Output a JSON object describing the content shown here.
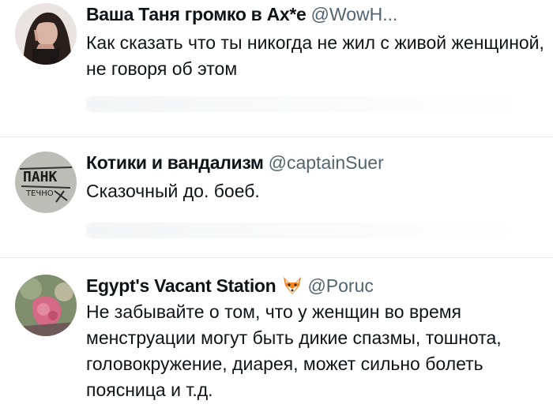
{
  "tweets": [
    {
      "display_name": "Ваша Таня громко в Ах*е",
      "handle": "@WowH...",
      "text": "Как сказать что ты никогда не жил с живой женщиной, не говоря об этом",
      "avatar_icon": "woman-portrait-avatar"
    },
    {
      "display_name": "Котики и вандализм",
      "handle": "@captainSuer",
      "text": "Сказочный до. боеб.",
      "avatar_icon": "graffiti-avatar",
      "avatar_graffiti_text": "ПАНК ТЕЧНО"
    },
    {
      "display_name": "Egypt's Vacant Station",
      "emoji": "fox-emoji",
      "handle": "@Poruc",
      "text": "Не забывайте о том, что у женщин во время менструации могут быть дикие спазмы, тошнота, головокружение, диарея, может сильно болеть поясница и т.д.",
      "avatar_icon": "pink-flower-avatar"
    }
  ],
  "colors": {
    "text": "#0f1419",
    "handle": "#536471",
    "divider": "#e6e9ec",
    "fox_orange": "#f5841f"
  }
}
